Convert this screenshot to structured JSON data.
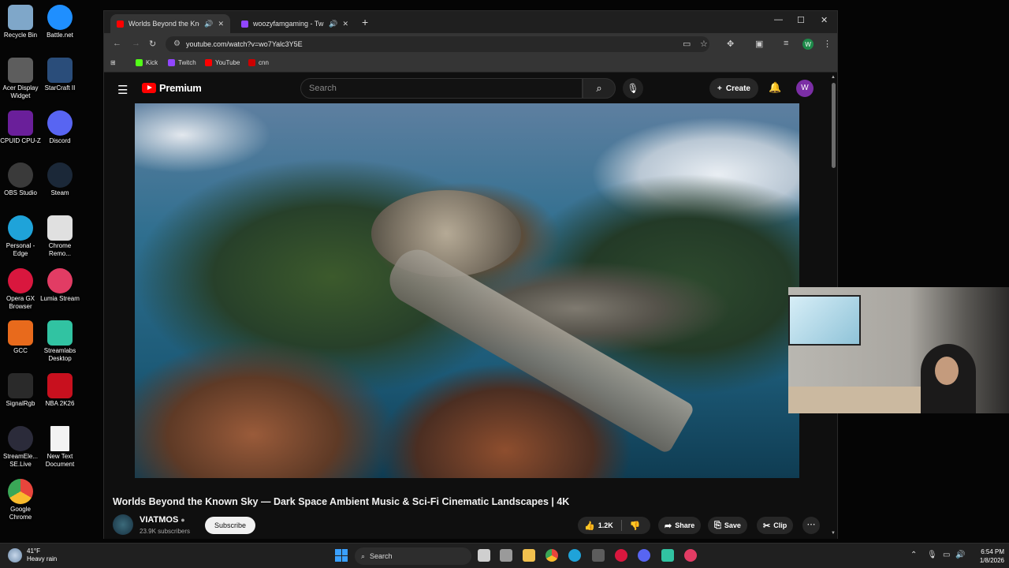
{
  "desktop": {
    "icons": [
      {
        "label": "Recycle Bin",
        "icon": "recycle-bin-icon",
        "color": "#7fa7c9"
      },
      {
        "label": "Battle.net",
        "icon": "battlenet-icon",
        "color": "#1f8fff"
      },
      {
        "label": "Acer Display Widget",
        "icon": "acer-icon",
        "color": "#5d5d5d"
      },
      {
        "label": "StarCraft II",
        "icon": "starcraft-icon",
        "color": "#2a4d7a"
      },
      {
        "label": "CPUID CPU-Z",
        "icon": "cpuz-icon",
        "color": "#6a1f9a"
      },
      {
        "label": "Discord",
        "icon": "discord-icon",
        "color": "#5865f2"
      },
      {
        "label": "OBS Studio",
        "icon": "obs-icon",
        "color": "#3a3a3a"
      },
      {
        "label": "Steam",
        "icon": "steam-icon",
        "color": "#1b2838"
      },
      {
        "label": "Personal - Edge",
        "icon": "edge-icon",
        "color": "#1fa3d9"
      },
      {
        "label": "Chrome Remo...",
        "icon": "chrome-remote-icon",
        "color": "#e0e0e0"
      },
      {
        "label": "Opera GX Browser",
        "icon": "opera-gx-icon",
        "color": "#d9173e"
      },
      {
        "label": "Lumia Stream",
        "icon": "lumia-icon",
        "color": "#e23c64"
      },
      {
        "label": "GCC",
        "icon": "gcc-icon",
        "color": "#e86a1c"
      },
      {
        "label": "Streamlabs Desktop",
        "icon": "streamlabs-icon",
        "color": "#31c3a2"
      },
      {
        "label": "SignalRgb",
        "icon": "signalrgb-icon",
        "color": "#2a2a2a"
      },
      {
        "label": "NBA 2K26",
        "icon": "nba2k-icon",
        "color": "#c8101e"
      },
      {
        "label": "StreamEle... SE.Live",
        "icon": "streamelements-icon",
        "color": "#2b2b3a"
      },
      {
        "label": "New Text Document",
        "icon": "text-document-icon",
        "color": "#f3f3f3"
      },
      {
        "label": "Google Chrome",
        "icon": "chrome-icon",
        "color": "#e8453c"
      }
    ]
  },
  "browser": {
    "tabs": [
      {
        "title": "Worlds Beyond the Known",
        "favicon": "youtube-favicon",
        "active": true
      },
      {
        "title": "woozyfamgaming - Twitch",
        "favicon": "twitch-favicon",
        "active": false
      }
    ],
    "url": "youtube.com/watch?v=wo7Yalc3Y5E",
    "bookmarks": [
      {
        "label": "Kick",
        "color": "#53fc18"
      },
      {
        "label": "Twitch",
        "color": "#9146ff"
      },
      {
        "label": "YouTube",
        "color": "#ff0000"
      },
      {
        "label": "cnn",
        "color": "#cc0000"
      }
    ],
    "profile_initial": "W"
  },
  "youtube": {
    "brand": "Premium",
    "search_placeholder": "Search",
    "create_label": "Create",
    "avatar_initial": "W",
    "video_title": "Worlds Beyond the Known Sky — Dark Space Ambient Music & Sci-Fi Cinematic Landscapes | 4K",
    "channel_name": "VIATMOS",
    "channel_subs": "23.9K subscribers",
    "subscribe_label": "Subscribe",
    "like_count": "1.2K",
    "share_label": "Share",
    "save_label": "Save",
    "clip_label": "Clip"
  },
  "taskbar": {
    "temperature": "41°F",
    "weather": "Heavy rain",
    "search_label": "Search",
    "time": "6:54 PM",
    "date": "1/8/2026"
  },
  "colors": {
    "youtube_red": "#ff0000",
    "windows_accent": "#3aa0ff"
  }
}
